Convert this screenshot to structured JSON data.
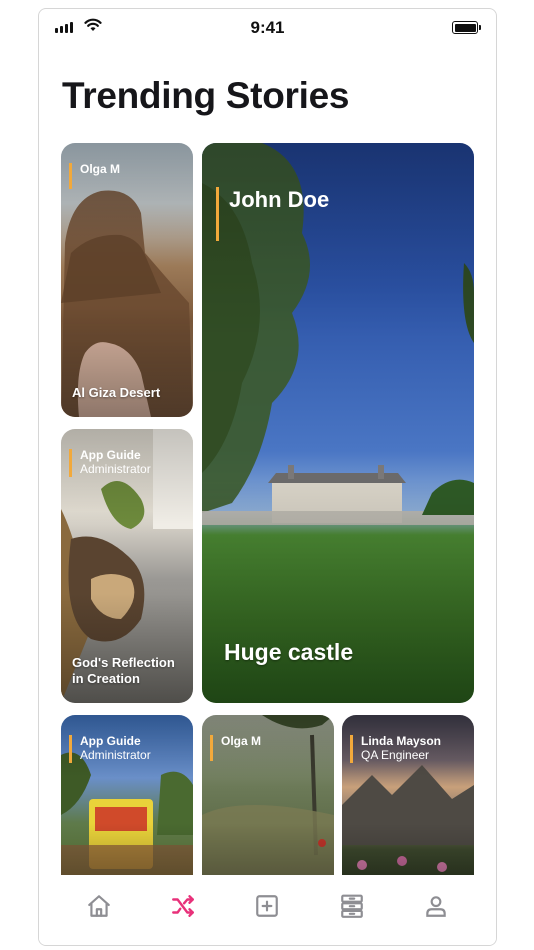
{
  "status_bar": {
    "time": "9:41"
  },
  "page": {
    "title": "Trending Stories"
  },
  "stories": [
    {
      "author": "Olga M",
      "role": "",
      "caption": "Al Giza Desert"
    },
    {
      "author": "John Doe",
      "role": "",
      "caption": "Huge castle"
    },
    {
      "author": "App Guide",
      "role": "Administrator",
      "caption": "God's Reflection in Creation"
    },
    {
      "author": "App Guide",
      "role": "Administrator",
      "caption": ""
    },
    {
      "author": "Olga M",
      "role": "",
      "caption": ""
    },
    {
      "author": "Linda Mayson",
      "role": "QA Engineer",
      "caption": ""
    }
  ],
  "tab_bar": {
    "active_color": "#e8317a",
    "inactive_color": "#8e8e93",
    "accent_color": "#f2a93b",
    "tabs": [
      {
        "icon": "home-icon",
        "active": false
      },
      {
        "icon": "shuffle-icon",
        "active": true
      },
      {
        "icon": "plus-square-icon",
        "active": false
      },
      {
        "icon": "list-icon",
        "active": false
      },
      {
        "icon": "user-icon",
        "active": false
      }
    ]
  }
}
